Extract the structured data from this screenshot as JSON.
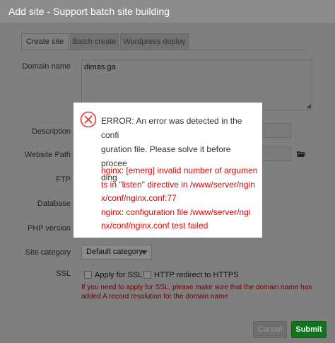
{
  "window": {
    "title": "Add site - Support batch site building"
  },
  "tabs": [
    {
      "label": "Create site",
      "active": true
    },
    {
      "label": "Batch create",
      "active": false
    },
    {
      "label": "Wordpress deploy",
      "active": false
    }
  ],
  "form": {
    "domain_label": "Domain name",
    "domain_value": "dimas.ga",
    "description_label": "Description",
    "website_path_label": "Website Path",
    "ftp_label": "FTP",
    "database_label": "Database",
    "php_label": "PHP version",
    "category_label": "Site category",
    "category_value": "Default category",
    "ssl_label": "SSL",
    "apply_ssl_label": "Apply for SSL",
    "http_redirect_label": "HTTP redirect to HTTPS",
    "ssl_warning": "If you need to apply for SSL, please make sure that the domain name has added A record resolution for the domain name"
  },
  "buttons": {
    "cancel": "Cancel",
    "submit": "Submit"
  },
  "error_popup": {
    "head_lines": [
      "ERROR: An error was detected in the confi",
      "guration file. Please solve it before procee",
      "ding"
    ],
    "detail_lines": [
      "nginx: [emerg] invalid number of argumen",
      "ts in \"listen\" directive in /www/server/ngin",
      "x/conf/nginx.conf:77",
      "nginx: configuration file /www/server/ngi",
      "nx/conf/nginx.conf test failed"
    ]
  },
  "colors": {
    "error": "#e20000",
    "submit": "#13711f",
    "overlay": "#7f7f7f"
  },
  "icons": {
    "error": "close-circle-icon",
    "folder": "folder-icon",
    "dropdown": "chevron-down-icon"
  }
}
